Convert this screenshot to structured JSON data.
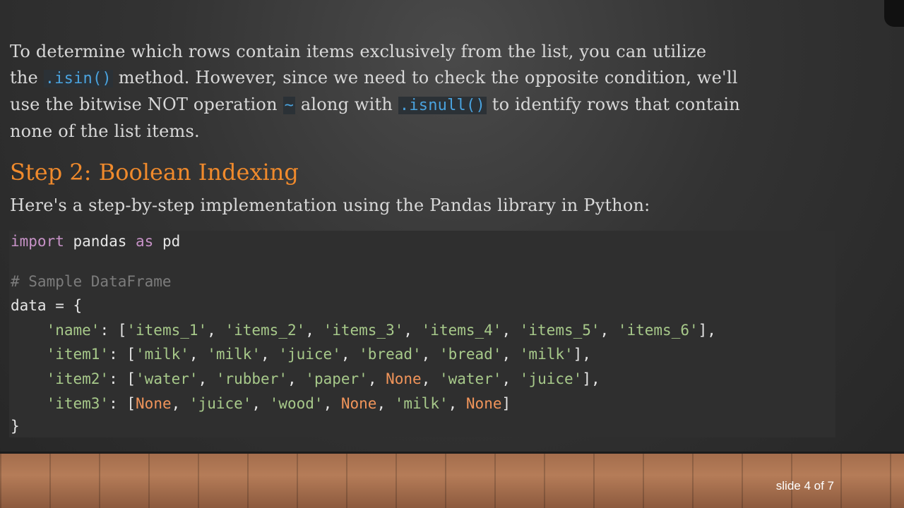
{
  "paragraph": {
    "p1": "To determine which rows contain items exclusively from the list, you can utilize",
    "p2a": "the ",
    "code_isin": ".isin()",
    "p2b": " method. However, since we need to check the opposite condition, we'll",
    "p3a": "use the bitwise NOT operation ",
    "code_tilde": "~",
    "p3b": " along with ",
    "code_isnull": ".isnull()",
    "p3c": " to identify rows that contain",
    "p4": "none of the list items."
  },
  "heading": "Step 2: Boolean Indexing",
  "intro": "Here's a step-by-step implementation using the Pandas library in Python:",
  "code": {
    "l1_kw1": "import",
    "l1_mid": " pandas ",
    "l1_kw2": "as",
    "l1_end": " pd",
    "l2_comment": "# Sample DataFrame",
    "l3": "data = {",
    "l4_key": "'name'",
    "l4_a": ": [",
    "l4_v1": "'items_1'",
    "l4_v2": "'items_2'",
    "l4_v3": "'items_3'",
    "l4_v4": "'items_4'",
    "l4_v5": "'items_5'",
    "l4_v6": "'items_6'",
    "l4_end": "],",
    "l5_key": "'item1'",
    "l5_a": ": [",
    "l5_v1": "'milk'",
    "l5_v2": "'milk'",
    "l5_v3": "'juice'",
    "l5_v4": "'bread'",
    "l5_v5": "'bread'",
    "l5_v6": "'milk'",
    "l5_end": "],",
    "l6_key": "'item2'",
    "l6_a": ": [",
    "l6_v1": "'water'",
    "l6_v2": "'rubber'",
    "l6_v3": "'paper'",
    "l6_v4": "None",
    "l6_v5": "'water'",
    "l6_v6": "'juice'",
    "l6_end": "],",
    "l7_key": "'item3'",
    "l7_a": ": [",
    "l7_v1": "None",
    "l7_v2": "'juice'",
    "l7_v3": "'wood'",
    "l7_v4": "None",
    "l7_v5": "'milk'",
    "l7_v6": "None",
    "l7_end": "]",
    "l8": "}",
    "sep": ", ",
    "indent": "    "
  },
  "slide_number": "slide 4 of 7"
}
